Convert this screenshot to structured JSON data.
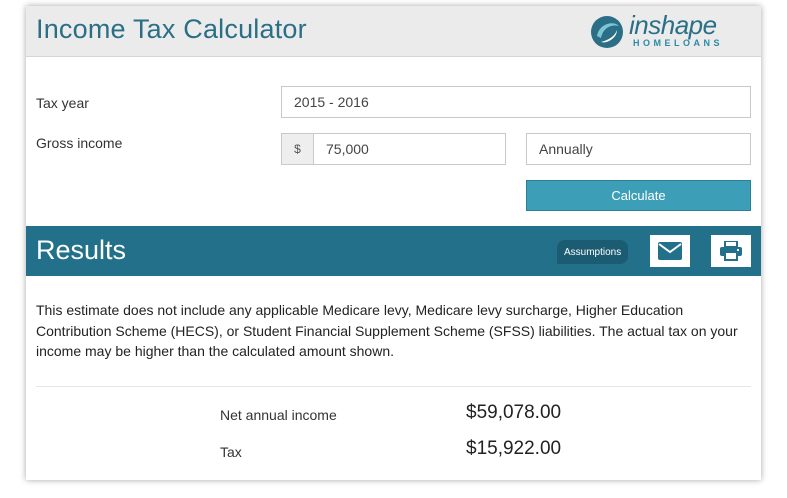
{
  "header": {
    "title": "Income Tax Calculator",
    "logo": {
      "name": "inshape",
      "sub": "HOMELOANS"
    }
  },
  "form": {
    "tax_year_label": "Tax year",
    "tax_year_value": "2015 - 2016",
    "gross_income_label": "Gross income",
    "currency_symbol": "$",
    "gross_income_value": "75,000",
    "frequency_value": "Annually",
    "calculate_label": "Calculate"
  },
  "results": {
    "title": "Results",
    "assumptions_label": "Assumptions",
    "email_icon": "envelope-icon",
    "print_icon": "printer-icon",
    "disclaimer": "This estimate does not include any applicable Medicare levy, Medicare levy surcharge, Higher Education Contribution Scheme (HECS), or Student Financial Supplement Scheme (SFSS) liabilities. The actual tax on your income may be higher than the calculated amount shown.",
    "rows": [
      {
        "label": "Net annual income",
        "value": "$59,078.00"
      },
      {
        "label": "Tax",
        "value": "$15,922.00"
      }
    ]
  },
  "colors": {
    "primary": "#22708a",
    "button": "#3d9fb7",
    "header_bg": "#ebebeb"
  }
}
